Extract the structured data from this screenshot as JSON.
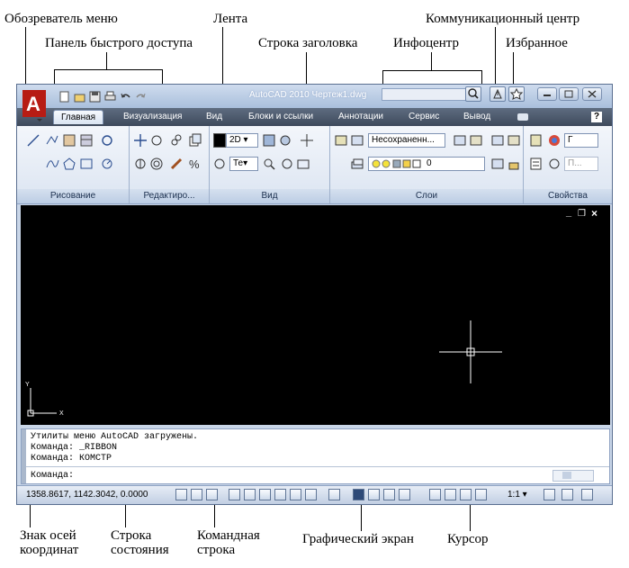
{
  "annotations": {
    "menu_browser": "Обозреватель меню",
    "quick_access": "Панель быстрого доступа",
    "ribbon": "Лента",
    "title_bar": "Строка заголовка",
    "infocenter": "Инфоцентр",
    "communication_center": "Коммуникационный центр",
    "favorites": "Избранное",
    "axis_sign_line1": "Знак осей",
    "axis_sign_line2": "координат",
    "status_bar_line1": "Строка",
    "status_bar_line2": "состояния",
    "command_line_line1": "Командная",
    "command_line_line2": "строка",
    "graphic_screen": "Графический экран",
    "cursor": "Курсор"
  },
  "window": {
    "title": "AutoCAD 2010 Чертеж1.dwg",
    "tabs": [
      "Главная",
      "Визуализация",
      "Вид",
      "Блоки и ссылки",
      "Аннотации",
      "Сервис",
      "Вывод"
    ],
    "active_tab": "Главная",
    "help_label": "?"
  },
  "ribbon": {
    "panels": [
      "Рисование",
      "Редактиро...",
      "Вид",
      "Слои",
      "Свойства"
    ],
    "view_combo": "2D ▾",
    "view_combo2": "Те▾",
    "layer_combo": "Несохраненн...",
    "layer_current": "0",
    "prop_combo": "Г",
    "prop_combo2": "П..."
  },
  "drawing": {
    "axis_y": "Y",
    "axis_x": "X",
    "viewport_min": "_",
    "viewport_restore": "❐",
    "viewport_close": "×"
  },
  "command": {
    "history": [
      "Утилиты меню AutoCAD загружены.",
      "Команда: _RIBBON",
      "Команда: КОМСТР"
    ],
    "prompt": "Команда:"
  },
  "status": {
    "coordinates": "1358.8617, 1142.3042, 0.0000",
    "scale": "1:1 ▾"
  },
  "icons": [
    "application-menu-icon",
    "new-icon",
    "open-icon",
    "save-icon",
    "print-icon",
    "undo-icon",
    "redo-icon",
    "search-icon",
    "communication-center-icon",
    "favorites-icon",
    "minimize-icon",
    "maximize-icon",
    "close-icon"
  ],
  "colors": {
    "accent_red": "#c8261e",
    "drawing_background": "#000000",
    "tab_bar": "#4a586c"
  }
}
